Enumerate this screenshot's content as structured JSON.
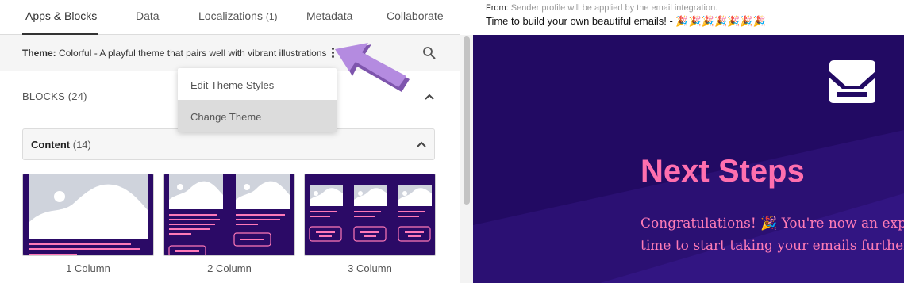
{
  "tabs": [
    {
      "label": "Apps & Blocks",
      "count": ""
    },
    {
      "label": "Data",
      "count": ""
    },
    {
      "label": "Localizations",
      "count": "(1)"
    },
    {
      "label": "Metadata",
      "count": ""
    },
    {
      "label": "Collaborate",
      "count": ""
    }
  ],
  "theme": {
    "label": "Theme:",
    "value": "Colorful - A playful theme that pairs well with vibrant illustrations"
  },
  "menu": {
    "items": [
      "Edit Theme Styles",
      "Change Theme"
    ]
  },
  "blocks": {
    "label": "BLOCKS",
    "count": "(24)"
  },
  "content_section": {
    "label": "Content",
    "count": "(14)"
  },
  "cards": [
    {
      "label": "1 Column"
    },
    {
      "label": "2 Column"
    },
    {
      "label": "3 Column"
    }
  ],
  "email": {
    "from_label": "From:",
    "from_note": "Sender profile will be applied by the email integration.",
    "subject": "Time to build your own beautiful emails! - 🎉🎉🎉🎉🎉🎉🎉",
    "heading": "Next Steps",
    "body_line1": "Congratulations! 🎉 You're now an expert",
    "body_line2": "time to start taking your emails further wi"
  },
  "colors": {
    "accent_pink": "#ff6fae",
    "email_bg": "#220a63",
    "arrow_purple": "#b48be0"
  }
}
